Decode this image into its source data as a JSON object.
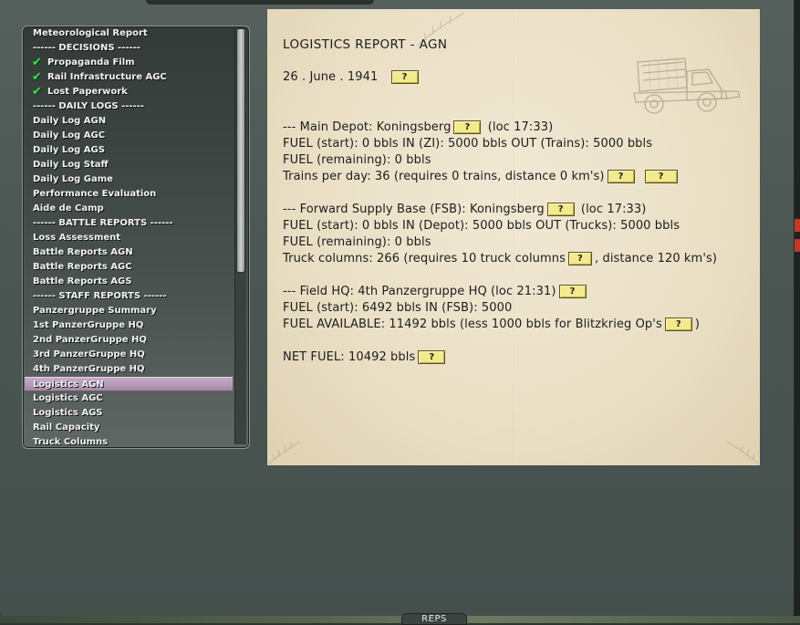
{
  "list": {
    "items": [
      {
        "label": "Meteorological Report",
        "type": "item"
      },
      {
        "label": "------ DECISIONS ------",
        "type": "header"
      },
      {
        "label": "Propaganda Film",
        "type": "checked"
      },
      {
        "label": "Rail Infrastructure AGC",
        "type": "checked"
      },
      {
        "label": "Lost Paperwork",
        "type": "checked"
      },
      {
        "label": "------ DAILY LOGS ------",
        "type": "header"
      },
      {
        "label": "Daily Log AGN",
        "type": "item"
      },
      {
        "label": "Daily Log AGC",
        "type": "item"
      },
      {
        "label": "Daily Log AGS",
        "type": "item"
      },
      {
        "label": "Daily Log Staff",
        "type": "item"
      },
      {
        "label": "Daily Log Game",
        "type": "item"
      },
      {
        "label": "Performance Evaluation",
        "type": "item"
      },
      {
        "label": "Aide de Camp",
        "type": "item"
      },
      {
        "label": "------ BATTLE REPORTS ------",
        "type": "header"
      },
      {
        "label": "Loss Assessment",
        "type": "item"
      },
      {
        "label": "Battle Reports AGN",
        "type": "item"
      },
      {
        "label": "Battle Reports AGC",
        "type": "item"
      },
      {
        "label": "Battle Reports AGS",
        "type": "item"
      },
      {
        "label": "------ STAFF REPORTS ------",
        "type": "header"
      },
      {
        "label": "Panzergruppe Summary",
        "type": "item"
      },
      {
        "label": "1st PanzerGruppe HQ",
        "type": "item"
      },
      {
        "label": "2nd PanzerGruppe HQ",
        "type": "item"
      },
      {
        "label": "3rd PanzerGruppe HQ",
        "type": "item"
      },
      {
        "label": "4th PanzerGruppe HQ",
        "type": "item"
      },
      {
        "label": "Logistics AGN",
        "type": "selected"
      },
      {
        "label": "Logistics AGC",
        "type": "item"
      },
      {
        "label": "Logistics AGS",
        "type": "item"
      },
      {
        "label": "Rail Capacity",
        "type": "item"
      },
      {
        "label": "Truck Columns",
        "type": "item"
      }
    ],
    "check_color": "#3fe04b",
    "selected_color": "#b99bbb"
  },
  "report": {
    "title": "LOGISTICS REPORT - AGN",
    "date": "26 . June . 1941",
    "help_label": "?",
    "main_depot": {
      "line1_a": "--- Main Depot: Koningsberg",
      "line1_b": "(loc 17:33)",
      "line2": "FUEL (start): 0 bbls  IN (ZI): 5000 bbls  OUT (Trains): 5000 bbls",
      "line3": "FUEL (remaining): 0 bbls",
      "line4": "Trains per day: 36  (requires 0 trains, distance 0 km's)"
    },
    "fsb": {
      "line1_a": "--- Forward Supply Base (FSB): Koningsberg",
      "line1_b": "(loc 17:33)",
      "line2": "FUEL (start): 0 bbls  IN (Depot): 5000 bbls  OUT (Trucks): 5000 bbls",
      "line3": "FUEL (remaining): 0 bbls",
      "line4_a": "Truck columns: 266  (requires 10 truck columns",
      "line4_b": ", distance 120 km's)"
    },
    "field_hq": {
      "line1_a": "--- Field HQ: 4th Panzergruppe HQ  (loc 21:31)",
      "line2": "FUEL (start): 6492 bbls  IN (FSB): 5000",
      "line3_a": "FUEL AVAILABLE: 11492 bbls  (less 1000 bbls for Blitzkrieg Op's",
      "line3_b": ")"
    },
    "net_fuel": "NET FUEL: 10492 bbls",
    "parchment_color": "#ebe0c6",
    "button_color": "#f3e98d"
  },
  "bottom_tab": {
    "label": "REPS"
  }
}
